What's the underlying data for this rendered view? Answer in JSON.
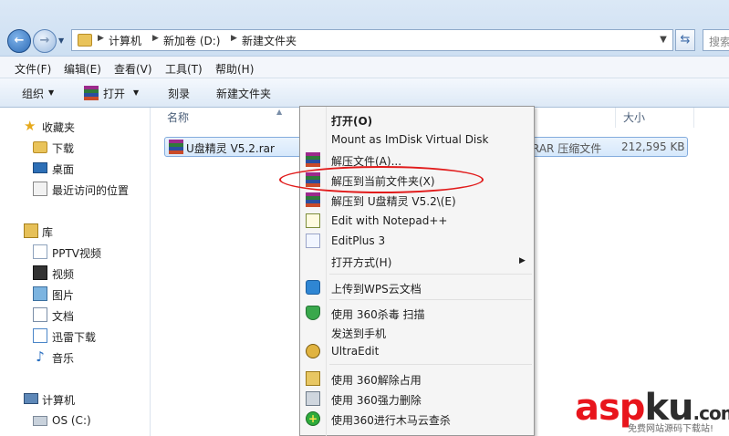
{
  "address": {
    "breadcrumbs": [
      "计算机",
      "新加卷 (D:)",
      "新建文件夹"
    ],
    "search_placeholder": "搜索"
  },
  "menubar": [
    "文件(F)",
    "编辑(E)",
    "查看(V)",
    "工具(T)",
    "帮助(H)"
  ],
  "toolbar": {
    "organize": "组织",
    "open": "打开",
    "burn": "刻录",
    "new_folder": "新建文件夹"
  },
  "nav": {
    "favorites": "收藏夹",
    "downloads": "下载",
    "desktop": "桌面",
    "recent": "最近访问的位置",
    "libraries": "库",
    "pptv": "PPTV视频",
    "videos": "视频",
    "pictures": "图片",
    "documents": "文档",
    "xunlei": "迅雷下载",
    "music": "音乐",
    "computer": "计算机",
    "os_drive": "OS (C:)"
  },
  "columns": {
    "name": "名称",
    "size": "大小"
  },
  "file": {
    "name": "U盘精灵 V5.2.rar",
    "type": "RAR 压缩文件",
    "size": "212,595 KB"
  },
  "context_menu": {
    "open": "打开(O)",
    "mount": "Mount as ImDisk Virtual Disk",
    "extract_files": "解压文件(A)...",
    "extract_here": "解压到当前文件夹(X)",
    "extract_to": "解压到 U盘精灵 V5.2\\(E)",
    "notepad": "Edit with Notepad++",
    "editplus": "EditPlus 3",
    "open_with": "打开方式(H)",
    "wps": "上传到WPS云文档",
    "scan360": "使用 360杀毒 扫描",
    "send_phone": "发送到手机",
    "ultraedit": "UltraEdit",
    "unlock360": "使用 360解除占用",
    "force_delete360": "使用 360强力删除",
    "trojan360": "使用360进行木马云查杀"
  },
  "watermark": {
    "brand_a": "asp",
    "brand_b": "ku",
    "brand_c": ".com",
    "tagline": "免费网站源码下载站!"
  },
  "colors": {
    "annotation": "#e11b1b",
    "selection": "#d6e8fb"
  }
}
